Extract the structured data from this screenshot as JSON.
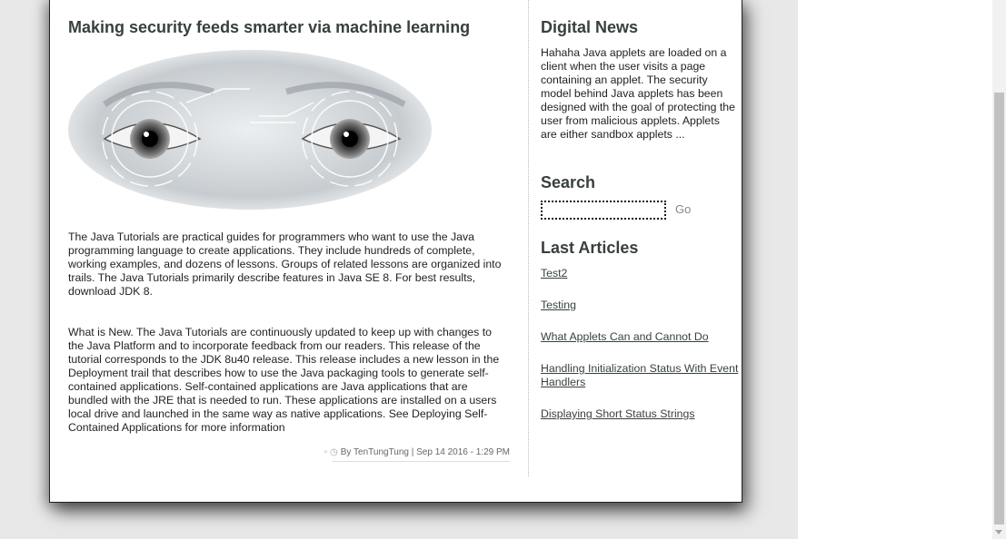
{
  "post": {
    "title": "Making security feeds smarter via machine learning",
    "image_alt": "eyes-with-scan-overlay",
    "paragraph1": "The Java Tutorials are practical guides for programmers who want to use the Java programming language to create applications. They include hundreds of complete, working examples, and dozens of lessons. Groups of related lessons are organized into trails. The Java Tutorials primarily describe features in Java SE 8. For best results, download JDK 8.",
    "paragraph2": "What is New. The Java Tutorials are continuously updated to keep up with changes to the Java Platform and to incorporate feedback from our readers. This release of the tutorial corresponds to the JDK 8u40 release. This release includes a new lesson in the Deployment trail that describes how to use the Java packaging tools to generate self-contained applications. Self-contained applications are Java applications that are bundled with the JRE that is needed to run. These applications are installed on a users local drive and launched in the same way as native applications. See Deploying Self-Contained Applications for more information",
    "meta": "By TenTungTung | Sep 14 2016 - 1:29 PM"
  },
  "sidebar": {
    "news_heading": "Digital News",
    "news_text": "Hahaha Java applets are loaded on a client when the user visits a page containing an applet. The security model behind Java applets has been designed with the goal of protecting the user from malicious applets. Applets are either sandbox applets ...",
    "search_heading": "Search",
    "search_value": "",
    "go_label": "Go",
    "articles_heading": "Last Articles",
    "articles": [
      "Test2",
      "Testing",
      "What Applets Can and Cannot Do",
      "Handling Initialization Status With Event Handlers",
      "Displaying Short Status Strings"
    ]
  }
}
